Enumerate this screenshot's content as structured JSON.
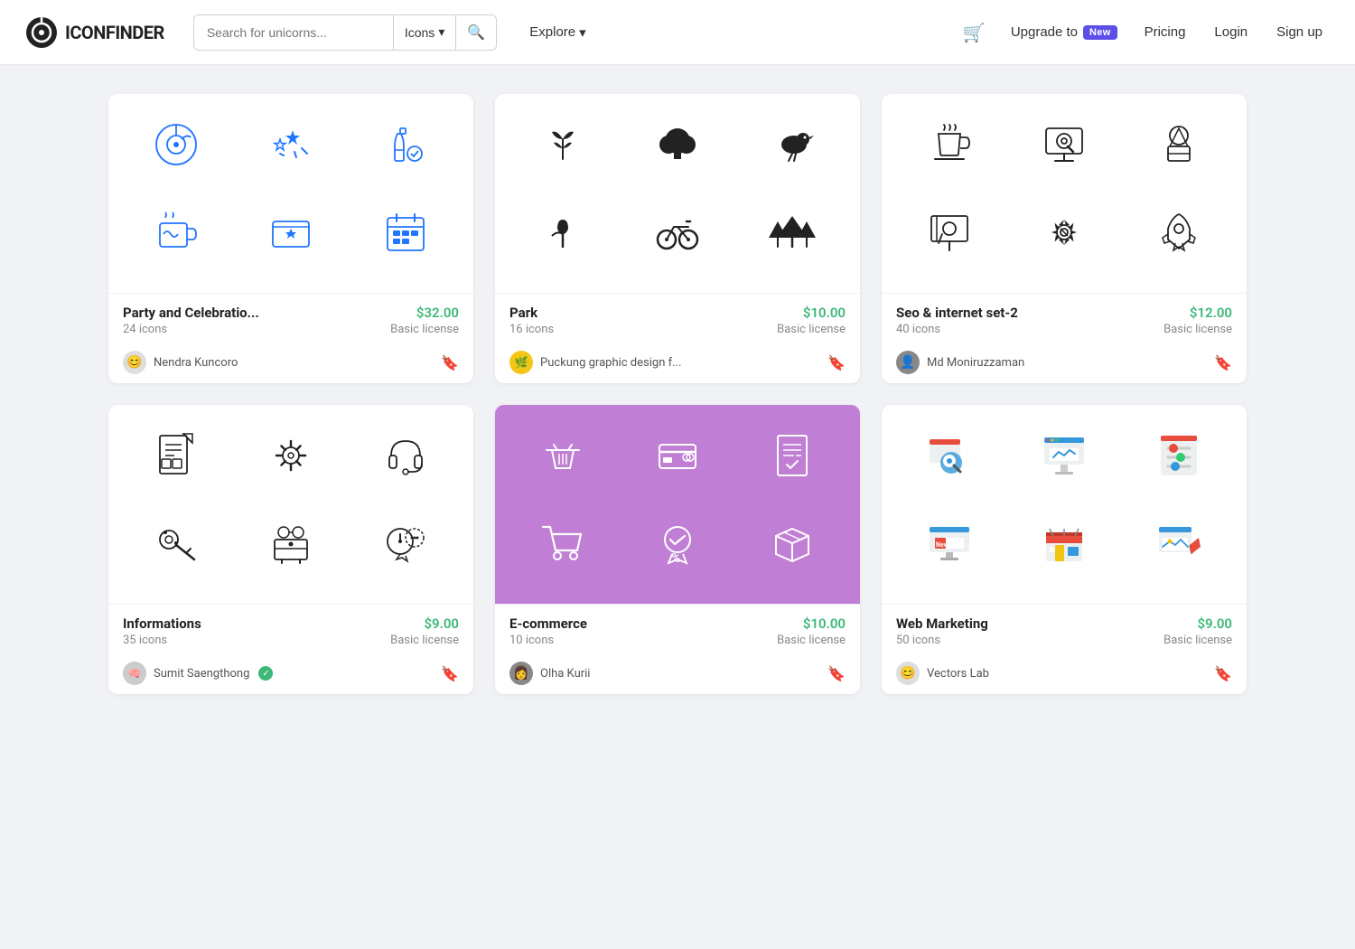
{
  "header": {
    "logo_text": "ICONFINDER",
    "search_placeholder": "Search for unicorns...",
    "search_type": "Icons",
    "explore_label": "Explore",
    "upgrade_label": "Upgrade to",
    "new_badge": "New",
    "pricing_label": "Pricing",
    "login_label": "Login",
    "signup_label": "Sign up"
  },
  "cards": [
    {
      "id": "party",
      "title": "Party and Celebratio...",
      "count": "24 icons",
      "price": "$32.00",
      "license": "Basic license",
      "author": "Nendra Kuncoro",
      "author_verified": false,
      "bg": "white"
    },
    {
      "id": "park",
      "title": "Park",
      "count": "16 icons",
      "price": "$10.00",
      "license": "Basic license",
      "author": "Puckung graphic design f...",
      "author_verified": false,
      "bg": "white"
    },
    {
      "id": "seo",
      "title": "Seo & internet set-2",
      "count": "40 icons",
      "price": "$12.00",
      "license": "Basic license",
      "author": "Md Moniruzzaman",
      "author_verified": false,
      "bg": "white"
    },
    {
      "id": "informations",
      "title": "Informations",
      "count": "35 icons",
      "price": "$9.00",
      "license": "Basic license",
      "author": "Sumit Saengthong",
      "author_verified": true,
      "bg": "white"
    },
    {
      "id": "ecommerce",
      "title": "E-commerce",
      "count": "10 icons",
      "price": "$10.00",
      "license": "Basic license",
      "author": "Olha Kurii",
      "author_verified": false,
      "bg": "purple"
    },
    {
      "id": "webmarketing",
      "title": "Web Marketing",
      "count": "50 icons",
      "price": "$9.00",
      "license": "Basic license",
      "author": "Vectors Lab",
      "author_verified": false,
      "bg": "white"
    }
  ]
}
